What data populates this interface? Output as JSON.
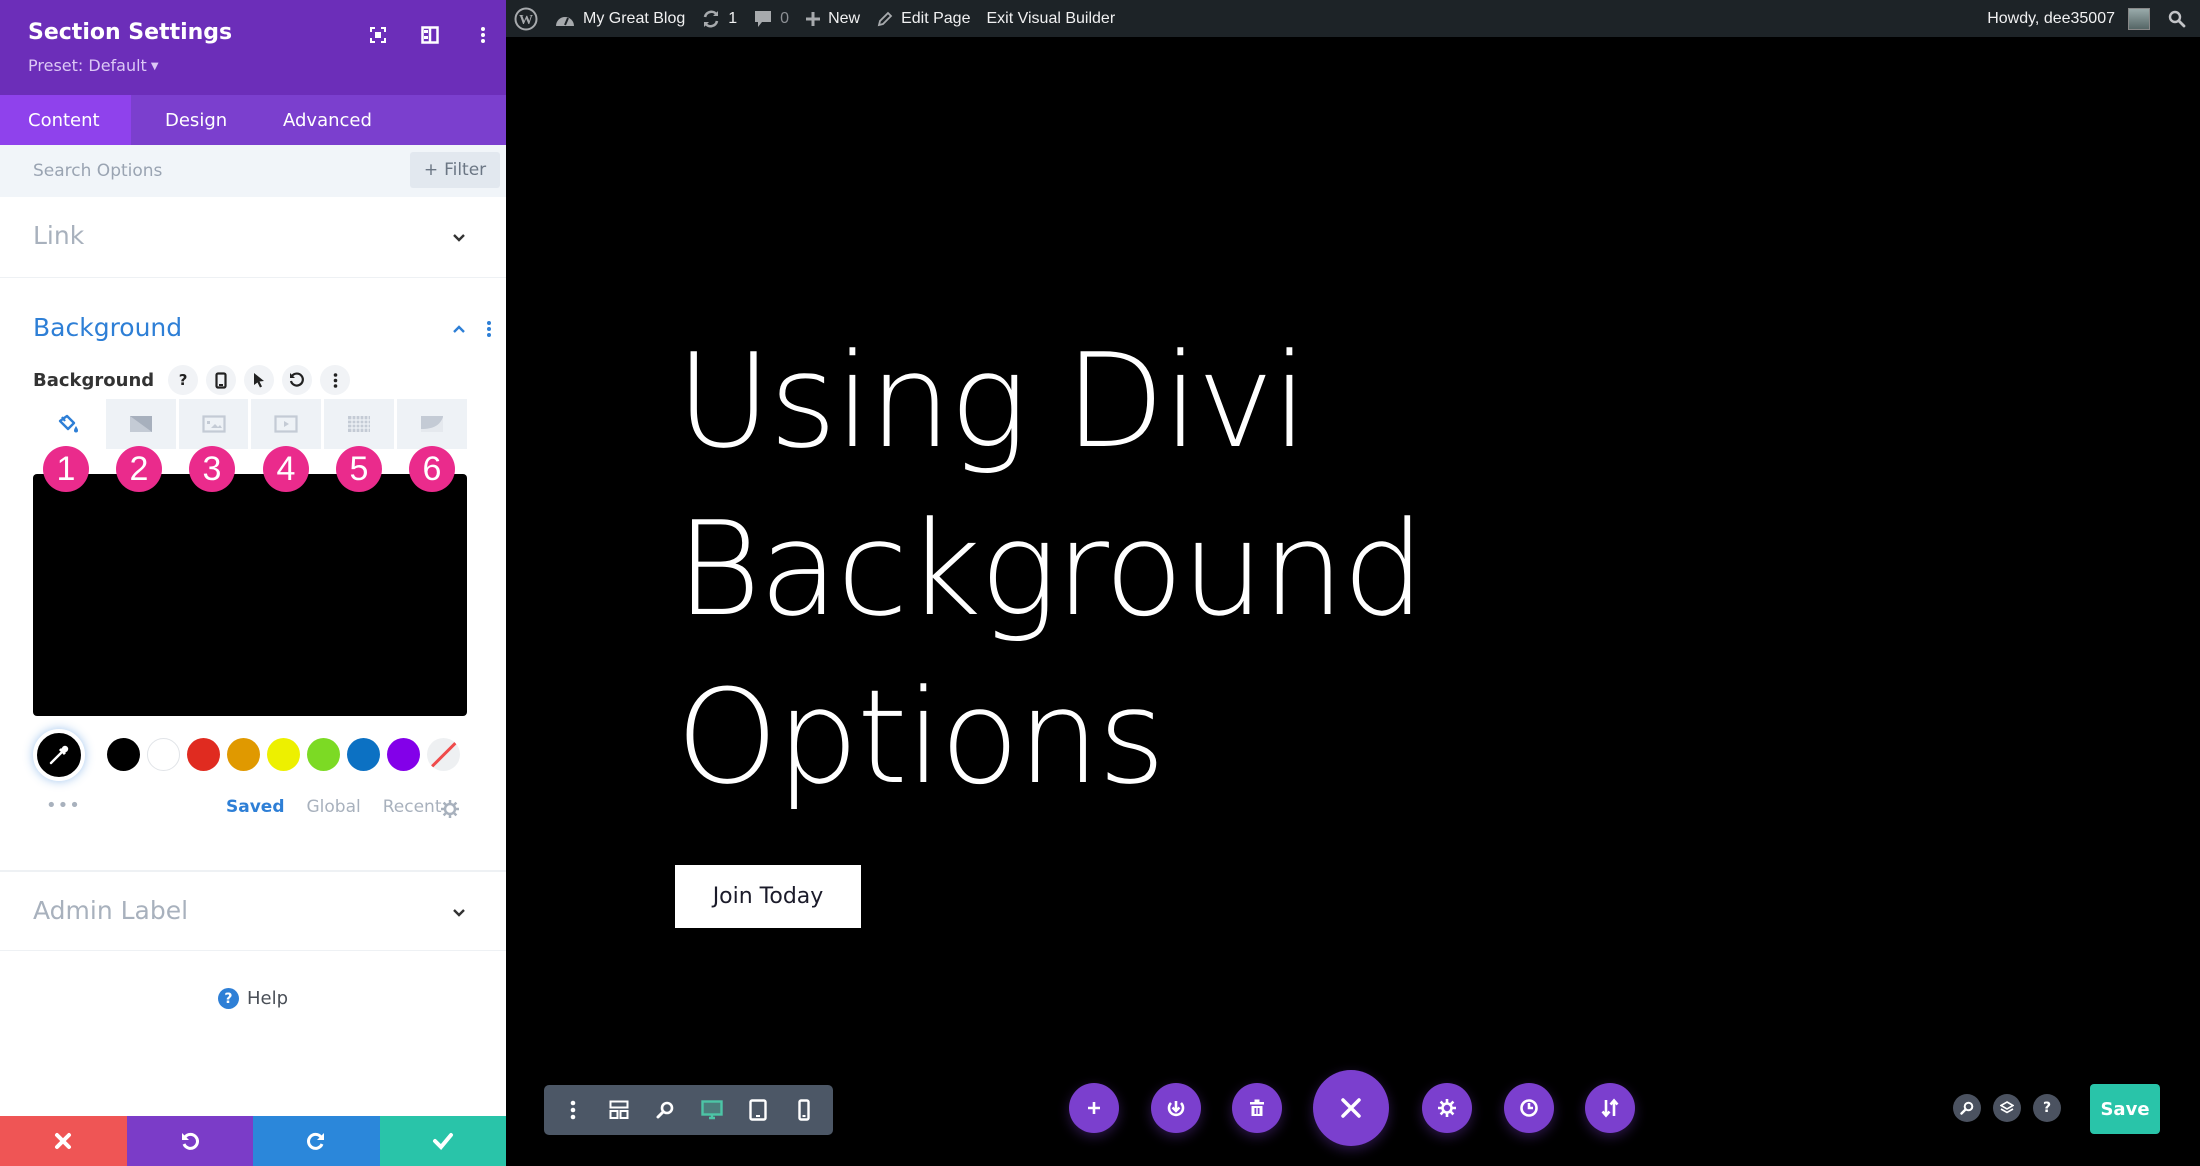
{
  "panel": {
    "title": "Section Settings",
    "preset": "Preset: Default",
    "tabs": [
      {
        "label": "Content",
        "active": true
      },
      {
        "label": "Design",
        "active": false
      },
      {
        "label": "Advanced",
        "active": false
      }
    ],
    "search": {
      "placeholder": "Search Options",
      "value": ""
    },
    "filter_label": "Filter",
    "sections": {
      "link": {
        "title": "Link",
        "expanded": false
      },
      "background": {
        "title": "Background",
        "expanded": true
      },
      "admin_label": {
        "title": "Admin Label",
        "expanded": false
      }
    },
    "background_field": {
      "label": "Background",
      "tool_icons": [
        "help-icon",
        "mobile-icon",
        "hover-cursor-icon",
        "reset-icon",
        "more-icon"
      ],
      "type_tabs": [
        {
          "icon": "paint-bucket-icon",
          "name": "color",
          "active": true
        },
        {
          "icon": "gradient-icon",
          "name": "gradient",
          "active": false
        },
        {
          "icon": "image-icon",
          "name": "image",
          "active": false
        },
        {
          "icon": "video-icon",
          "name": "video",
          "active": false
        },
        {
          "icon": "pattern-icon",
          "name": "pattern",
          "active": false
        },
        {
          "icon": "mask-icon",
          "name": "mask",
          "active": false
        }
      ],
      "annotations": [
        "1",
        "2",
        "3",
        "4",
        "5",
        "6"
      ],
      "annotation_color": "#ea2b8c",
      "current_color": "#000000",
      "swatches": [
        "#000000",
        "#ffffff",
        "#e02b20",
        "#e09900",
        "#edf000",
        "#7cda24",
        "#0c71c3",
        "#8300e9",
        "none"
      ],
      "palette_tabs": [
        {
          "label": "Saved",
          "active": true
        },
        {
          "label": "Global",
          "active": false
        },
        {
          "label": "Recent",
          "active": false
        }
      ],
      "more_dots": "•••"
    },
    "help_label": "Help",
    "footer_colors": {
      "cancel": "#ef5555",
      "undo": "#7b3cc8",
      "redo": "#2b87da",
      "save": "#29c4a9"
    }
  },
  "adminbar": {
    "site_name": "My Great Blog",
    "updates_count": "1",
    "comments_count": "0",
    "new_label": "New",
    "edit_page_label": "Edit Page",
    "exit_label": "Exit Visual Builder",
    "greeting": "Howdy, dee35007"
  },
  "canvas": {
    "hero_lines": [
      "Using Divi",
      "Background",
      "Options"
    ],
    "cta_label": "Join Today",
    "save_label": "Save",
    "accent": "#7b3fce",
    "active_view_color": "#4cc5a6"
  }
}
